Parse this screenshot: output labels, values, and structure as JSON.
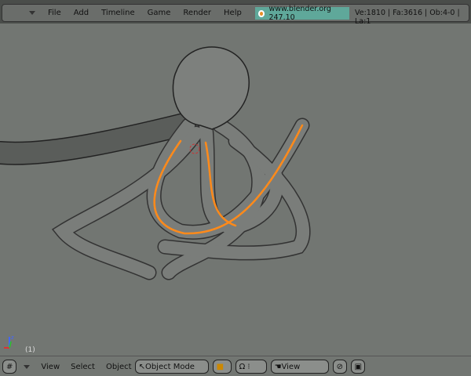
{
  "menu": [
    "File",
    "Add",
    "Timeline",
    "Game",
    "Render",
    "Help"
  ],
  "brand": "www.blender.org 247.10",
  "stats": "Ve:1810 | Fa:3616 | Ob:4-0 | La:1",
  "viewport": {
    "frame": "(1)",
    "axis_label": "z"
  },
  "bottom": {
    "view": "View",
    "select": "Select",
    "object": "Object",
    "mode": "Object Mode",
    "pivot_view": "View"
  },
  "colors": {
    "selected_edge": "#ff8a1a",
    "background": "#727672"
  }
}
